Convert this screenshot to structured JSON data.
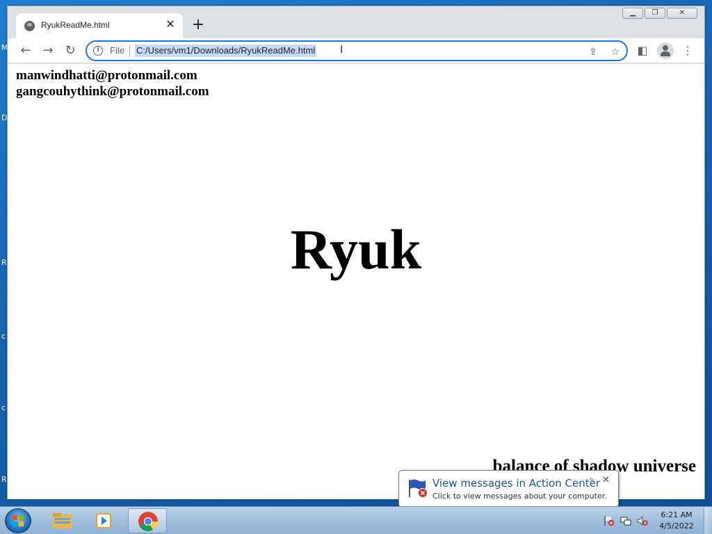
{
  "browser": {
    "tab_title": "RyukReadMe.html",
    "scheme_label": "File",
    "url": "C:/Users/vm1/Downloads/RyukReadMe.html"
  },
  "page": {
    "emails": [
      "manwindhatti@protonmail.com",
      "gangcouhythink@protonmail.com"
    ],
    "headline": "Ryuk",
    "footer": "balance of shadow universe"
  },
  "notification": {
    "title": "View messages in Action Center",
    "text": "Click to view messages about your computer."
  },
  "taskbar": {
    "time": "6:21 AM",
    "date": "4/5/2022",
    "pinned": [
      "explorer-icon",
      "media-player-icon",
      "chrome-icon"
    ]
  },
  "desktop": {
    "edge_letters": [
      "M",
      "D",
      "R",
      "c",
      "c",
      "R"
    ]
  },
  "colors": {
    "omnibox_focus": "#1a73e8",
    "url_selection": "#c7daf7",
    "notification_title": "#1e50a2"
  }
}
